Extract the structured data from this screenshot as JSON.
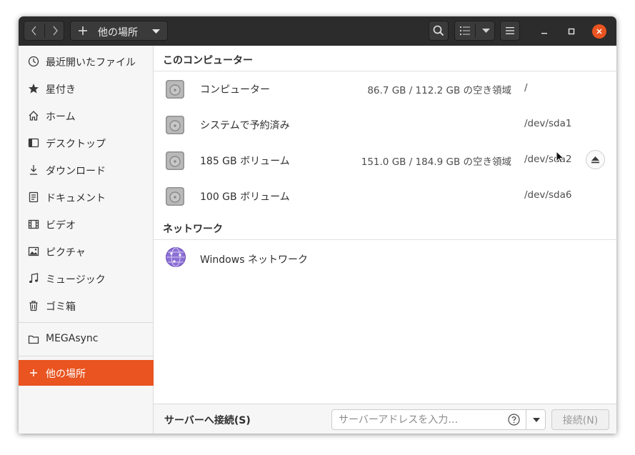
{
  "headerbar": {
    "location_label": "他の場所"
  },
  "sidebar": {
    "items": [
      {
        "label": "最近開いたファイル",
        "icon": "clock-icon"
      },
      {
        "label": "星付き",
        "icon": "star-icon"
      },
      {
        "label": "ホーム",
        "icon": "home-icon"
      },
      {
        "label": "デスクトップ",
        "icon": "desktop-icon"
      },
      {
        "label": "ダウンロード",
        "icon": "download-icon"
      },
      {
        "label": "ドキュメント",
        "icon": "document-icon"
      },
      {
        "label": "ビデオ",
        "icon": "video-icon"
      },
      {
        "label": "ピクチャ",
        "icon": "picture-icon"
      },
      {
        "label": "ミュージック",
        "icon": "music-icon"
      },
      {
        "label": "ゴミ箱",
        "icon": "trash-icon"
      }
    ],
    "bookmark": {
      "label": "MEGAsync",
      "icon": "folder-icon"
    },
    "other_locations": {
      "label": "他の場所",
      "icon": "plus-icon"
    }
  },
  "main": {
    "computer_section_title": "このコンピューター",
    "drives": [
      {
        "name": "コンピューター",
        "space": "86.7 GB / 112.2 GB の空き領域",
        "path": "/",
        "icon": "drive-icon"
      },
      {
        "name": "システムで予約済み",
        "space": "",
        "path": "/dev/sda1",
        "icon": "drive-icon"
      },
      {
        "name": "185 GB ボリューム",
        "space": "151.0 GB / 184.9 GB の空き領域",
        "path": "/dev/sda2",
        "icon": "drive-icon",
        "eject": true
      },
      {
        "name": "100 GB ボリューム",
        "space": "",
        "path": "/dev/sda6",
        "icon": "drive-icon"
      }
    ],
    "network_section_title": "ネットワーク",
    "networks": [
      {
        "name": "Windows ネットワーク",
        "icon": "network-globe-icon"
      }
    ]
  },
  "actionbar": {
    "connect_label": "サーバーへ接続(S)",
    "address_placeholder": "サーバーアドレスを入力…",
    "connect_button": "接続(N)"
  },
  "colors": {
    "accent": "#e95420",
    "headerbar": "#2c2c2c",
    "sidebar": "#f6f6f6"
  }
}
